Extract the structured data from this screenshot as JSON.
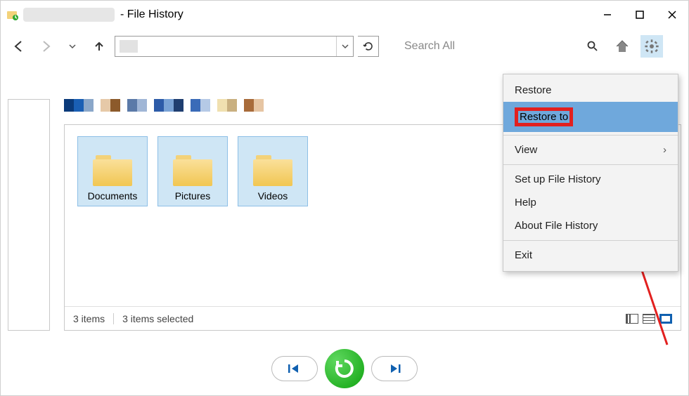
{
  "window": {
    "title_suffix": "- File History"
  },
  "toolbar": {
    "search_placeholder": "Search All"
  },
  "items": [
    {
      "label": "Documents"
    },
    {
      "label": "Pictures"
    },
    {
      "label": "Videos"
    }
  ],
  "status": {
    "count_text": "3 items",
    "selection_text": "3 items selected"
  },
  "menu": {
    "restore": "Restore",
    "restore_to": "Restore to",
    "view": "View",
    "setup": "Set up File History",
    "help": "Help",
    "about": "About File History",
    "exit": "Exit"
  },
  "colors": {
    "highlight": "#e2201f",
    "menu_hover": "#6fa8dc",
    "selection": "#cfe6f5",
    "restore_green": "#0fa30f"
  },
  "color_strip": [
    {
      "w": 14,
      "c": "#0a3a7a"
    },
    {
      "w": 14,
      "c": "#1a5fb4"
    },
    {
      "w": 14,
      "c": "#8aa7c9"
    },
    {
      "w": 10,
      "c": "#ffffff"
    },
    {
      "w": 14,
      "c": "#e6c9a8"
    },
    {
      "w": 14,
      "c": "#8c5a2b"
    },
    {
      "w": 10,
      "c": "#ffffff"
    },
    {
      "w": 14,
      "c": "#5b7aa8"
    },
    {
      "w": 14,
      "c": "#a0b6d6"
    },
    {
      "w": 10,
      "c": "#ffffff"
    },
    {
      "w": 14,
      "c": "#2d5ba8"
    },
    {
      "w": 14,
      "c": "#7aa3d6"
    },
    {
      "w": 14,
      "c": "#1f3e70"
    },
    {
      "w": 10,
      "c": "#ffffff"
    },
    {
      "w": 14,
      "c": "#3a6bb8"
    },
    {
      "w": 14,
      "c": "#b5c9e6"
    },
    {
      "w": 10,
      "c": "#ffffff"
    },
    {
      "w": 14,
      "c": "#f0e0b0"
    },
    {
      "w": 14,
      "c": "#c9b080"
    },
    {
      "w": 10,
      "c": "#ffffff"
    },
    {
      "w": 14,
      "c": "#a86b3a"
    },
    {
      "w": 14,
      "c": "#e6c5a3"
    }
  ]
}
